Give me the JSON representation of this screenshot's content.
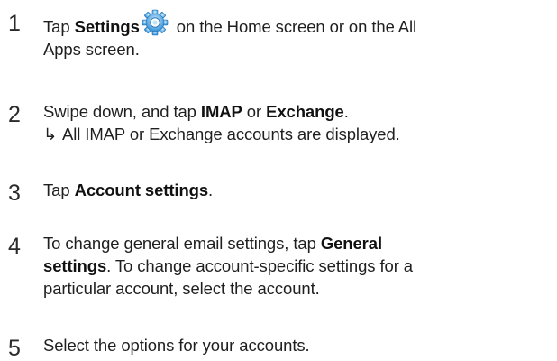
{
  "steps": [
    {
      "number": "1",
      "pre": "Tap ",
      "bold": "Settings",
      "icon": "settings-gear-icon",
      "post": " on the Home screen or on the All",
      "line2": "Apps screen."
    },
    {
      "number": "2",
      "pre": "Swipe down, and tap ",
      "bold1": "IMAP",
      "mid": " or ",
      "bold2": "Exchange",
      "post": ".",
      "result_arrow": "↳",
      "result": "All IMAP or Exchange accounts are displayed."
    },
    {
      "number": "3",
      "pre": "Tap ",
      "bold": "Account settings",
      "post": "."
    },
    {
      "number": "4",
      "pre": "To change general email settings, tap ",
      "bold_a": "General",
      "bold_b": "settings",
      "mid": ". To change account-specific settings for a",
      "line3": "particular account, select the account."
    },
    {
      "number": "5",
      "text": "Select the options for your accounts."
    }
  ],
  "colors": {
    "text": "#1f1f1f",
    "icon_blue": "#2e8fd6",
    "icon_light": "#bfe3f7"
  }
}
